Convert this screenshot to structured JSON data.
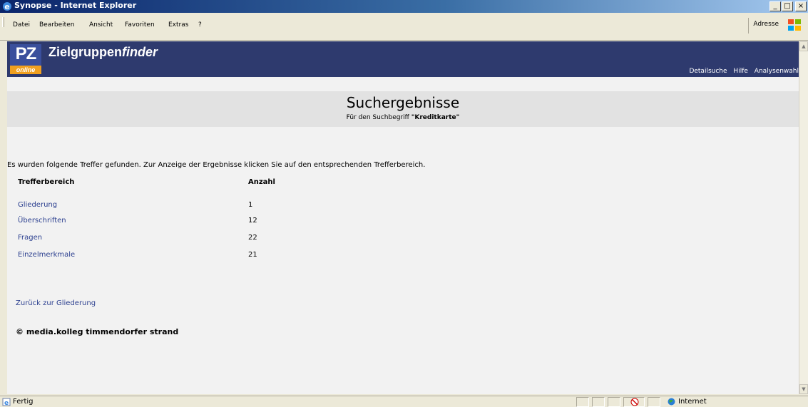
{
  "window": {
    "title": "Synopse - Internet Explorer",
    "controls": [
      "_",
      "□",
      "×"
    ]
  },
  "menubar": {
    "items": [
      "Datei",
      "Bearbeiten",
      "Ansicht",
      "Favoriten",
      "Extras",
      "?"
    ],
    "address_label": "Adresse"
  },
  "banner": {
    "logo_main": "PZ",
    "logo_sub": "online",
    "brand_plain": "Zielgruppen",
    "brand_italic": "finder",
    "nav": [
      "Detailsuche",
      "Hilfe",
      "Analysenwahl"
    ]
  },
  "heading": {
    "title": "Suchergebnisse",
    "subtitle_prefix": "Für den Suchbegriff ",
    "subtitle_term": "\"Kreditkarte\""
  },
  "results": {
    "intro": "Es wurden folgende Treffer gefunden. Zur Anzeige der Ergebnisse klicken Sie auf den entsprechenden Trefferbereich.",
    "columns": [
      "Trefferbereich",
      "Anzahl"
    ],
    "rows": [
      {
        "label": "Gliederung",
        "count": "1"
      },
      {
        "label": "Überschriften",
        "count": "12"
      },
      {
        "label": "Fragen",
        "count": "22"
      },
      {
        "label": "Einzelmerkmale",
        "count": "21"
      }
    ]
  },
  "footer": {
    "back_link": "Zurück zur Gliederung",
    "copyright": "© media.kolleg timmendorfer strand"
  },
  "statusbar": {
    "status": "Fertig",
    "zone": "Internet"
  }
}
